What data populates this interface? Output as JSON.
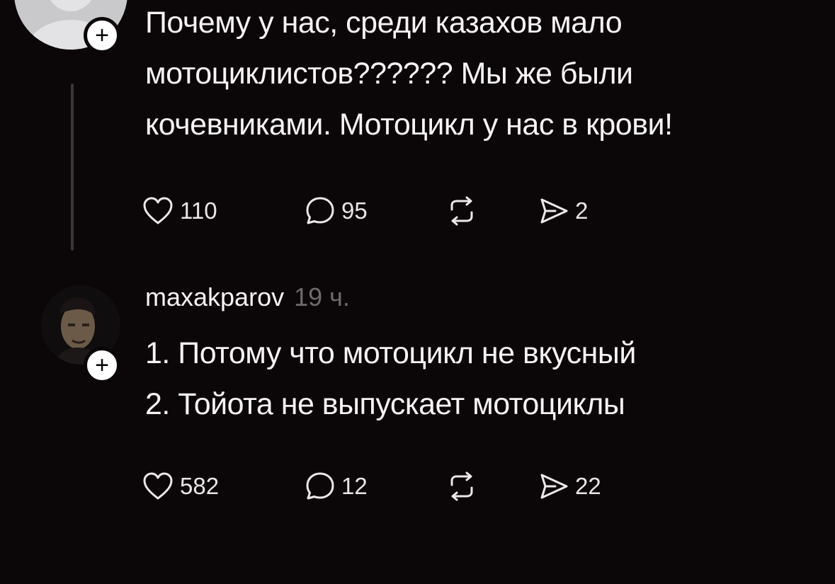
{
  "post1": {
    "text": "Почему у нас, среди казахов мало\nмотоциклистов?????? Мы же были\nкочевниками. Мотоцикл у нас в крови!",
    "follow_badge": "+",
    "likes": "110",
    "comments": "95",
    "shares": "2"
  },
  "post2": {
    "username": "maxakparov",
    "time": "19 ч.",
    "text": "1. Потому что мотоцикл не вкусный\n2. Тойота не выпускает мотоциклы",
    "follow_badge": "+",
    "likes": "582",
    "comments": "12",
    "shares": "22"
  },
  "icons": {
    "like": "heart-icon",
    "comment": "comment-bubble-icon",
    "repost": "repost-icon",
    "share": "send-icon",
    "follow": "plus-icon"
  },
  "colors": {
    "background": "#0b0607",
    "text": "#f6f3f4",
    "muted": "#6f6a6b",
    "thread_line": "#3a3536"
  }
}
